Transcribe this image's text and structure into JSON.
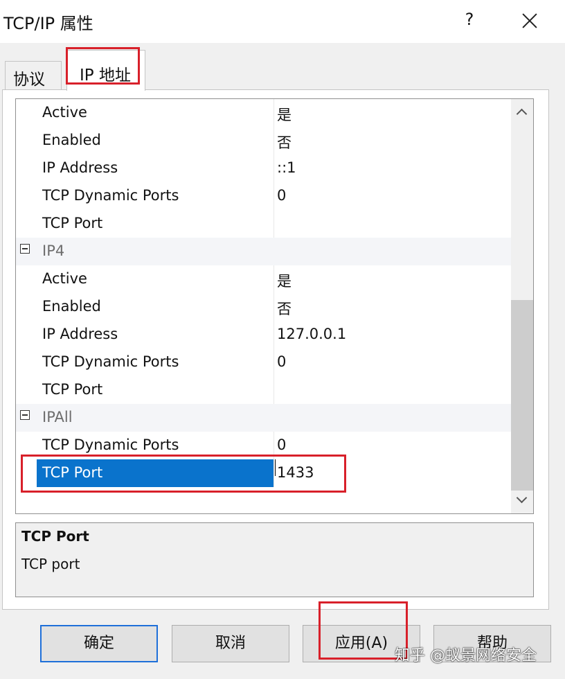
{
  "window": {
    "title": "TCP/IP 属性",
    "help": "?",
    "close": "close"
  },
  "tabs": [
    {
      "label": "协议"
    },
    {
      "label": "IP 地址"
    }
  ],
  "grid": {
    "rows": [
      {
        "name": "Active",
        "value": "是"
      },
      {
        "name": "Enabled",
        "value": "否"
      },
      {
        "name": "IP Address",
        "value": "::1"
      },
      {
        "name": "TCP Dynamic Ports",
        "value": "0"
      },
      {
        "name": "TCP Port",
        "value": ""
      },
      {
        "category": "IP4"
      },
      {
        "name": "Active",
        "value": "是"
      },
      {
        "name": "Enabled",
        "value": "否"
      },
      {
        "name": "IP Address",
        "value": "127.0.0.1"
      },
      {
        "name": "TCP Dynamic Ports",
        "value": "0"
      },
      {
        "name": "TCP Port",
        "value": ""
      },
      {
        "category": "IPAll"
      },
      {
        "name": "TCP Dynamic Ports",
        "value": "0"
      },
      {
        "name": "TCP Port",
        "value": "1433",
        "selected": true
      }
    ]
  },
  "description": {
    "title": "TCP Port",
    "text": "TCP port"
  },
  "buttons": {
    "ok": "确定",
    "cancel": "取消",
    "apply": "应用(A)",
    "help": "帮助"
  },
  "watermark": "知乎 @蚁景网络安全",
  "colors": {
    "selection": "#0a73cc",
    "highlight_box": "#d8202a",
    "default_button_border": "#1e6fd9"
  }
}
